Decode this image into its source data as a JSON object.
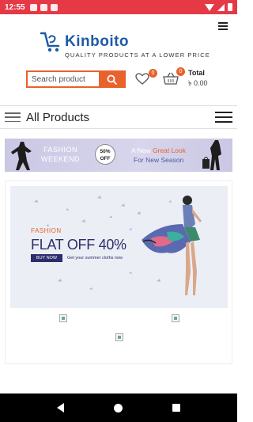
{
  "status_bar": {
    "time": "12:55"
  },
  "header": {
    "brand_name": "Kinboito",
    "tagline": "QUALITY PRODUCTS AT A LOWER PRICE",
    "search": {
      "placeholder": "Search product"
    },
    "wishlist": {
      "count": "0"
    },
    "cart": {
      "count": "0"
    },
    "total": {
      "label": "Total",
      "amount": "৳ 0.00"
    }
  },
  "products_bar": {
    "title": "All Products"
  },
  "banner": {
    "fashion_weekend": [
      "FASHION",
      "WEEKEND"
    ],
    "discount": [
      "50%",
      "OFF"
    ],
    "line1_prefix": "A New",
    "line1_highlight": "Great Look",
    "line2": "For New Season"
  },
  "promo": {
    "kicker": "FASHION",
    "headline": "FLAT OFF 40%",
    "cta": "BUY NOW",
    "subtext": "Get your summer cloths now"
  },
  "colors": {
    "status_bar": "#e63946",
    "accent": "#e8622c",
    "brand": "#1e5aa8",
    "promo_navy": "#2b2f6b"
  }
}
